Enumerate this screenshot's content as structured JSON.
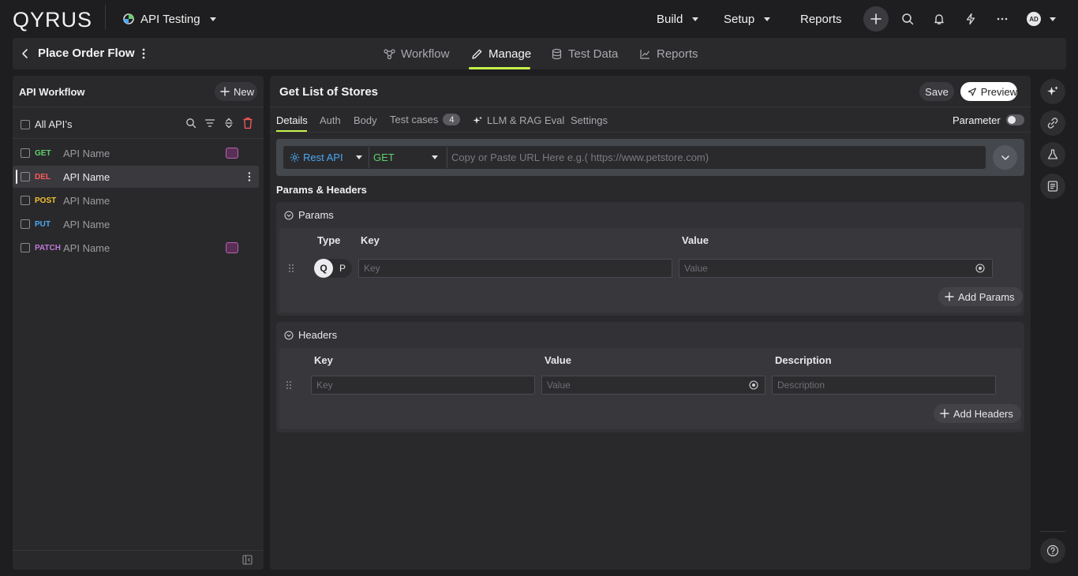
{
  "app": {
    "logo": "QYRUS",
    "project": "API Testing",
    "nav": [
      "Build",
      "Setup",
      "Reports"
    ],
    "avatar_initials": "AD"
  },
  "flow": {
    "title": "Place Order Flow",
    "tabs": [
      "Workflow",
      "Manage",
      "Test Data",
      "Reports"
    ],
    "active_tab": "Manage"
  },
  "left_panel": {
    "title": "API Workflow",
    "new_label": "New",
    "all_apis_label": "All API’s",
    "apis": [
      {
        "method": "GET",
        "name": "API Name",
        "method_color": "#5fcf6a",
        "has_badge": true
      },
      {
        "method": "DEL",
        "name": "API Name",
        "method_color": "#ff5a5a",
        "has_badge": false,
        "selected": true
      },
      {
        "method": "POST",
        "name": "API Name",
        "method_color": "#f2c230",
        "has_badge": false
      },
      {
        "method": "PUT",
        "name": "API Name",
        "method_color": "#4aa8f0",
        "has_badge": false
      },
      {
        "method": "PATCH",
        "name": "API Name",
        "method_color": "#c07ad8",
        "has_badge": true
      }
    ]
  },
  "main": {
    "title": "Get List of Stores",
    "save_label": "Save",
    "preview_label": "Preview",
    "tabs": [
      "Details",
      "Auth",
      "Body",
      "Test cases",
      "LLM & RAG Eval",
      "Settings"
    ],
    "test_cases_count": "4",
    "parameter_label": "Parameter",
    "api_type": "Rest API",
    "http_method": "GET",
    "url_placeholder": "Copy or Paste URL Here  e.g.( https://www.petstore.com)",
    "params_headers_title": "Params & Headers",
    "params": {
      "title": "Params",
      "col_type": "Type",
      "col_key": "Key",
      "col_value": "Value",
      "type_q": "Q",
      "type_p": "P",
      "key_placeholder": "Key",
      "value_placeholder": "Value",
      "add_label": "Add Params"
    },
    "headers": {
      "title": "Headers",
      "col_key": "Key",
      "col_value": "Value",
      "col_description": "Description",
      "key_placeholder": "Key",
      "value_placeholder": "Value",
      "description_placeholder": "Description",
      "add_label": "Add Headers"
    }
  },
  "colors": {
    "accent": "#c6f24a",
    "rest_api": "#4aa8f0",
    "get_method": "#5fcf6a",
    "delete_icon": "#ff5a5a"
  }
}
